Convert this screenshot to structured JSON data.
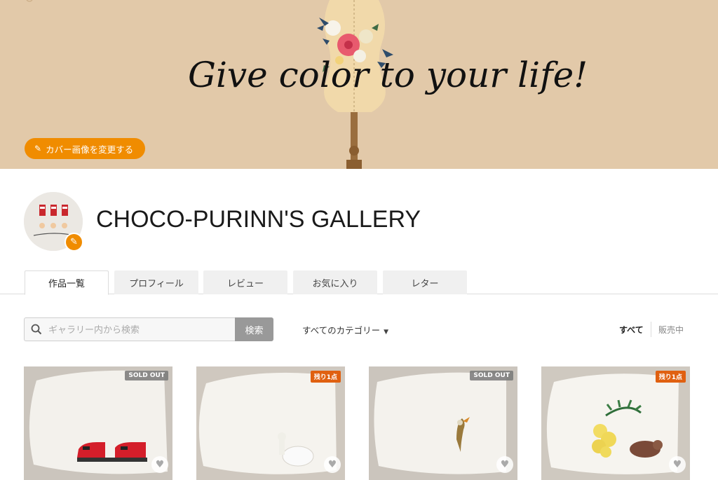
{
  "cover": {
    "title": "Give color to your life!",
    "change_button_label": "カバー画像を変更する"
  },
  "profile": {
    "gallery_name": "CHOCO-PURINN'S GALLERY"
  },
  "tabs": [
    {
      "label": "作品一覧",
      "active": true
    },
    {
      "label": "プロフィール",
      "active": false
    },
    {
      "label": "レビュー",
      "active": false
    },
    {
      "label": "お気に入り",
      "active": false
    },
    {
      "label": "レター",
      "active": false
    }
  ],
  "search": {
    "placeholder": "ギャラリー内から検索",
    "button_label": "検索"
  },
  "category_dropdown": {
    "selected": "すべてのカテゴリー"
  },
  "filters": {
    "all": "すべて",
    "on_sale": "販売中"
  },
  "products": [
    {
      "badge": "SOLD OUT",
      "badge_type": "soldout",
      "motif": "red-train-icon"
    },
    {
      "badge": "残り1点",
      "badge_type": "remain",
      "motif": "white-alpaca-icon"
    },
    {
      "badge": "SOLD OUT",
      "badge_type": "soldout",
      "motif": "bird-icon"
    },
    {
      "badge": "残り1点",
      "badge_type": "remain",
      "motif": "mimosa-cat-icon"
    }
  ],
  "colors": {
    "accent": "#f08c00",
    "cover_bg": "#e2c9a9",
    "remain_badge": "#e06010"
  }
}
